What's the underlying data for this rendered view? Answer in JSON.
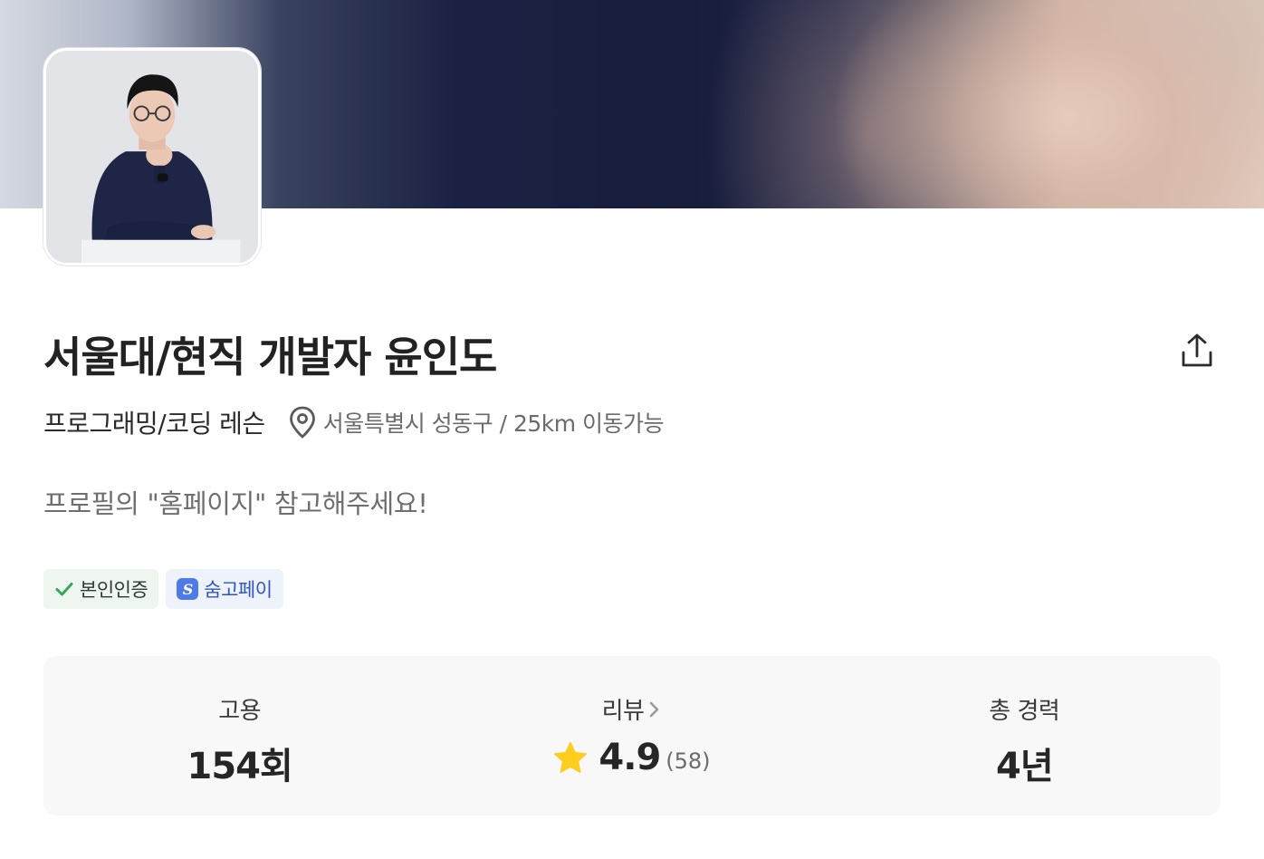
{
  "profile": {
    "title": "서울대/현직 개발자 윤인도",
    "category": "프로그래밍/코딩 레슨",
    "location": "서울특별시 성동구 / 25km 이동가능",
    "description": "프로필의 \"홈페이지\" 참고해주세요!"
  },
  "badges": {
    "verified": "본인인증",
    "pay": "숨고페이",
    "pay_icon_glyph": "S"
  },
  "stats": {
    "hires_label": "고용",
    "hires_value": "154회",
    "review_label": "리뷰",
    "review_rating": "4.9",
    "review_count": "(58)",
    "career_label": "총 경력",
    "career_value": "4년"
  },
  "icons": {
    "share": "share-icon",
    "location": "location-pin-icon",
    "check": "check-icon",
    "star": "star-icon",
    "chevron": "chevron-right-icon"
  },
  "colors": {
    "verify_check": "#3aa55a",
    "pay_text": "#2f55c5",
    "star": "#ffcd1e"
  }
}
